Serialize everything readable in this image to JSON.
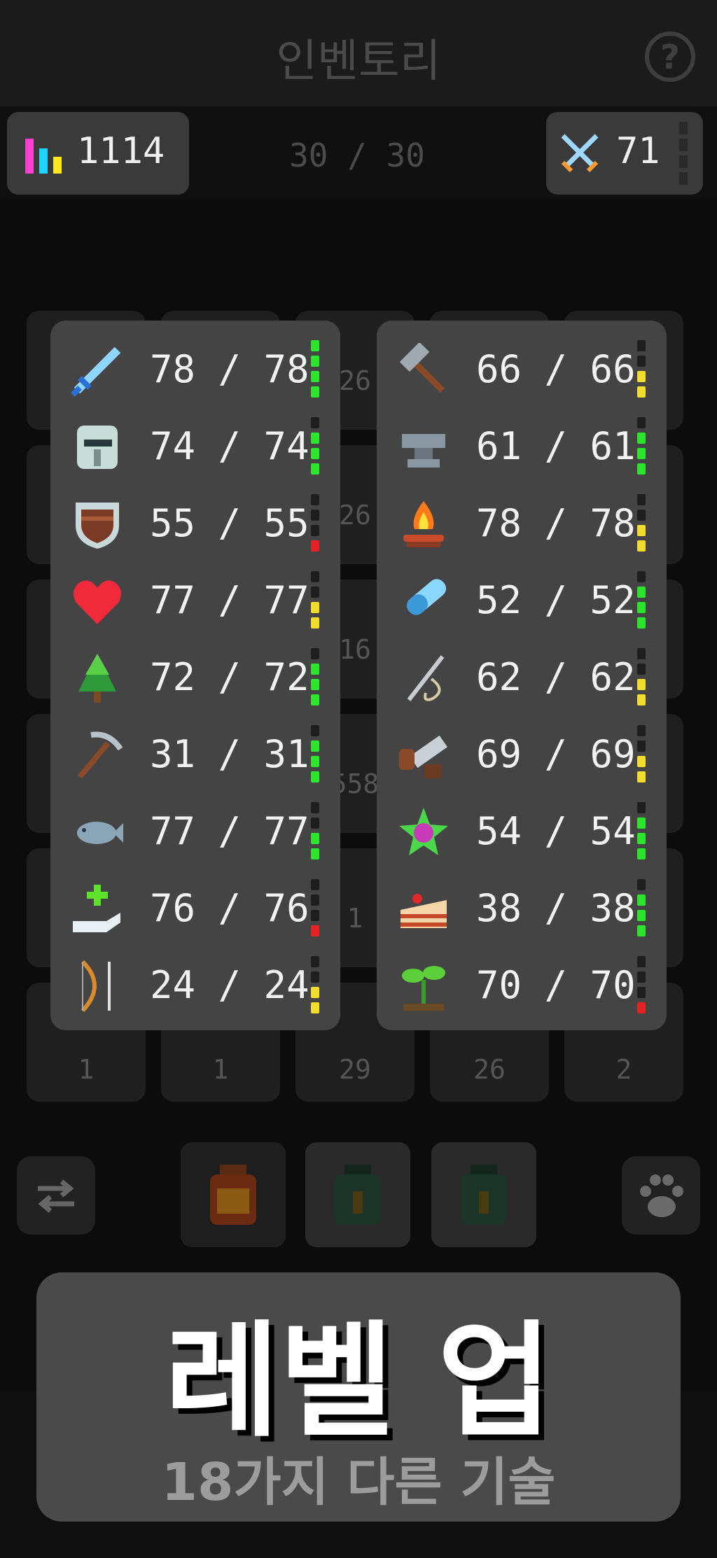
{
  "header": {
    "title": "인벤토리",
    "help_label": "?"
  },
  "topbar": {
    "power": "1114",
    "capacity": "30 / 30",
    "combat_level": "71"
  },
  "inventory_counts": [
    "26",
    "26",
    "16",
    "558",
    "1",
    "1",
    "1",
    "29",
    "26",
    "2"
  ],
  "left_skills": [
    {
      "icon": "sword-icon",
      "value": "78 / 78",
      "bar": [
        1,
        1,
        1,
        1
      ],
      "color": "#2ee52e"
    },
    {
      "icon": "helmet-icon",
      "value": "74 / 74",
      "bar": [
        0,
        1,
        1,
        1
      ],
      "color": "#2ee52e"
    },
    {
      "icon": "shield-icon",
      "value": "55 / 55",
      "bar": [
        0,
        0,
        0,
        1
      ],
      "color": "#e52323"
    },
    {
      "icon": "heart-icon",
      "value": "77 / 77",
      "bar": [
        0,
        0,
        1,
        1
      ],
      "color": "#f2dc2e"
    },
    {
      "icon": "tree-icon",
      "value": "72 / 72",
      "bar": [
        0,
        1,
        1,
        1
      ],
      "color": "#2ee52e"
    },
    {
      "icon": "pickaxe-icon",
      "value": "31 / 31",
      "bar": [
        0,
        1,
        1,
        1
      ],
      "color": "#2ee52e"
    },
    {
      "icon": "fish-icon",
      "value": "77 / 77",
      "bar": [
        0,
        0,
        1,
        1
      ],
      "color": "#2ee52e"
    },
    {
      "icon": "healing-hand-icon",
      "value": "76 / 76",
      "bar": [
        0,
        0,
        0,
        1
      ],
      "color": "#e52323"
    },
    {
      "icon": "bow-icon",
      "value": "24 / 24",
      "bar": [
        0,
        0,
        1,
        1
      ],
      "color": "#f2dc2e"
    }
  ],
  "right_skills": [
    {
      "icon": "hammer-icon",
      "value": "66 / 66",
      "bar": [
        0,
        0,
        1,
        1
      ],
      "color": "#f2dc2e"
    },
    {
      "icon": "anvil-icon",
      "value": "61 / 61",
      "bar": [
        0,
        1,
        1,
        1
      ],
      "color": "#2ee52e"
    },
    {
      "icon": "campfire-icon",
      "value": "78 / 78",
      "bar": [
        0,
        0,
        1,
        1
      ],
      "color": "#f2dc2e"
    },
    {
      "icon": "potion-vial-icon",
      "value": "52 / 52",
      "bar": [
        0,
        1,
        1,
        1
      ],
      "color": "#2ee52e"
    },
    {
      "icon": "needle-icon",
      "value": "62 / 62",
      "bar": [
        0,
        0,
        1,
        1
      ],
      "color": "#f2dc2e"
    },
    {
      "icon": "saw-icon",
      "value": "69 / 69",
      "bar": [
        0,
        0,
        1,
        1
      ],
      "color": "#f2dc2e"
    },
    {
      "icon": "magic-gem-icon",
      "value": "54 / 54",
      "bar": [
        0,
        1,
        1,
        1
      ],
      "color": "#2ee52e"
    },
    {
      "icon": "cake-icon",
      "value": "38 / 38",
      "bar": [
        0,
        1,
        1,
        1
      ],
      "color": "#2ee52e"
    },
    {
      "icon": "sprout-icon",
      "value": "70 / 70",
      "bar": [
        0,
        0,
        0,
        1
      ],
      "color": "#e52323"
    }
  ],
  "banner": {
    "title": "레벨 업",
    "subtitle": "18가지 다른 기술"
  }
}
